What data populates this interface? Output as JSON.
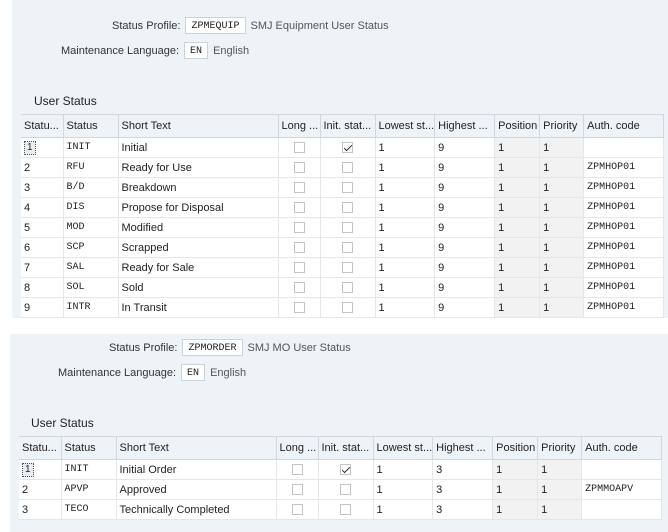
{
  "profiles": [
    {
      "status_profile_label": "Status Profile:",
      "status_profile_code": "ZPMEQUIP",
      "status_profile_desc": "SMJ Equipment User Status",
      "maint_lang_label": "Maintenance Language:",
      "lang_code": "EN",
      "lang_name": "English",
      "section_title": "User Status",
      "columns": [
        "Statu...",
        "Status",
        "Short Text",
        "Long ...",
        "Init. stat...",
        "Lowest st...",
        "Highest ...",
        "Position",
        "Priority",
        "Auth. code"
      ],
      "rows": [
        {
          "num": "1",
          "status": "INIT",
          "text": "Initial",
          "long": false,
          "init": true,
          "low": "1",
          "high": "9",
          "pos": "1",
          "prio": "1",
          "auth": ""
        },
        {
          "num": "2",
          "status": "RFU",
          "text": "Ready for Use",
          "long": false,
          "init": false,
          "low": "1",
          "high": "9",
          "pos": "1",
          "prio": "1",
          "auth": "ZPMHOP01"
        },
        {
          "num": "3",
          "status": "B/D",
          "text": "Breakdown",
          "long": false,
          "init": false,
          "low": "1",
          "high": "9",
          "pos": "1",
          "prio": "1",
          "auth": "ZPMHOP01"
        },
        {
          "num": "4",
          "status": "DIS",
          "text": "Propose for Disposal",
          "long": false,
          "init": false,
          "low": "1",
          "high": "9",
          "pos": "1",
          "prio": "1",
          "auth": "ZPMHOP01"
        },
        {
          "num": "5",
          "status": "MOD",
          "text": "Modified",
          "long": false,
          "init": false,
          "low": "1",
          "high": "9",
          "pos": "1",
          "prio": "1",
          "auth": "ZPMHOP01"
        },
        {
          "num": "6",
          "status": "SCP",
          "text": "Scrapped",
          "long": false,
          "init": false,
          "low": "1",
          "high": "9",
          "pos": "1",
          "prio": "1",
          "auth": "ZPMHOP01"
        },
        {
          "num": "7",
          "status": "SAL",
          "text": "Ready for Sale",
          "long": false,
          "init": false,
          "low": "1",
          "high": "9",
          "pos": "1",
          "prio": "1",
          "auth": "ZPMHOP01"
        },
        {
          "num": "8",
          "status": "SOL",
          "text": "Sold",
          "long": false,
          "init": false,
          "low": "1",
          "high": "9",
          "pos": "1",
          "prio": "1",
          "auth": "ZPMHOP01"
        },
        {
          "num": "9",
          "status": "INTR",
          "text": "In Transit",
          "long": false,
          "init": false,
          "low": "1",
          "high": "9",
          "pos": "1",
          "prio": "1",
          "auth": "ZPMHOP01"
        }
      ]
    },
    {
      "status_profile_label": "Status Profile:",
      "status_profile_code": "ZPMORDER",
      "status_profile_desc": "SMJ MO User Status",
      "maint_lang_label": "Maintenance Language:",
      "lang_code": "EN",
      "lang_name": "English",
      "section_title": "User Status",
      "columns": [
        "Statu...",
        "Status",
        "Short Text",
        "Long ...",
        "Init. stat...",
        "Lowest st...",
        "Highest ...",
        "Position",
        "Priority",
        "Auth. code"
      ],
      "rows": [
        {
          "num": "1",
          "status": "INIT",
          "text": "Initial Order",
          "long": false,
          "init": true,
          "low": "1",
          "high": "3",
          "pos": "1",
          "prio": "1",
          "auth": ""
        },
        {
          "num": "2",
          "status": "APVP",
          "text": "Approved",
          "long": false,
          "init": false,
          "low": "1",
          "high": "3",
          "pos": "1",
          "prio": "1",
          "auth": "ZPMMOAPV"
        },
        {
          "num": "3",
          "status": "TECO",
          "text": "Technically Completed",
          "long": false,
          "init": false,
          "low": "1",
          "high": "3",
          "pos": "1",
          "prio": "1",
          "auth": ""
        }
      ]
    }
  ]
}
